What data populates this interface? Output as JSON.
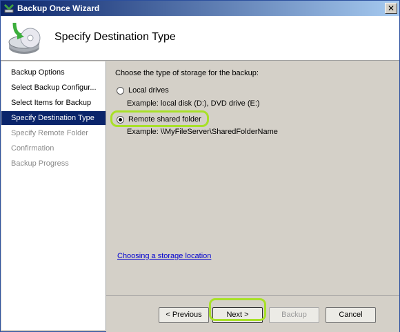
{
  "window": {
    "title": "Backup Once Wizard",
    "close_glyph": "✕"
  },
  "header": {
    "title": "Specify Destination Type",
    "icon": "backup-drive-icon"
  },
  "sidebar": {
    "items": [
      {
        "label": "Backup Options",
        "state": "normal"
      },
      {
        "label": "Select Backup Configur...",
        "state": "normal"
      },
      {
        "label": "Select Items for Backup",
        "state": "normal"
      },
      {
        "label": "Specify Destination Type",
        "state": "active"
      },
      {
        "label": "Specify Remote Folder",
        "state": "disabled"
      },
      {
        "label": "Confirmation",
        "state": "disabled"
      },
      {
        "label": "Backup Progress",
        "state": "disabled"
      }
    ]
  },
  "main": {
    "prompt": "Choose the type of storage for the backup:",
    "options": [
      {
        "label": "Local drives",
        "example": "Example: local disk (D:), DVD drive (E:)",
        "selected": false
      },
      {
        "label": "Remote shared folder",
        "example": "Example: \\\\MyFileServer\\SharedFolderName",
        "selected": true
      }
    ],
    "help_link": "Choosing a storage location"
  },
  "buttons": {
    "previous": "< Previous",
    "next": "Next >",
    "backup": "Backup",
    "cancel": "Cancel"
  },
  "colors": {
    "active_item_bg": "#0a246a",
    "highlight": "#a8e028",
    "link": "#0000d0"
  }
}
